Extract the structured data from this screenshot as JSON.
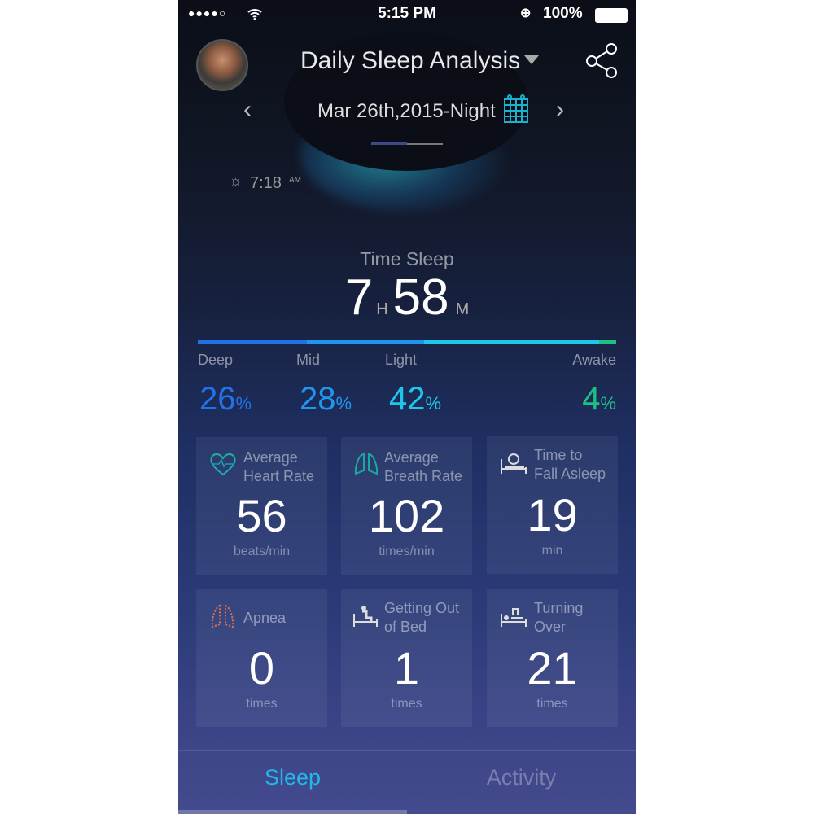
{
  "status_bar": {
    "signal_bars": 4,
    "signal_total": 5,
    "time": "5:15 PM",
    "battery": "100%"
  },
  "header": {
    "title": "Daily Sleep Analysis",
    "date": "Mar 26th,2015-Night",
    "wake_time": "7:18",
    "wake_ampm": "AM"
  },
  "summary": {
    "label": "Time Sleep",
    "hours": "7",
    "hours_unit": "H",
    "minutes": "58",
    "minutes_unit": "M"
  },
  "phases": [
    {
      "label": "Deep",
      "value": "26",
      "unit": "%",
      "percent": 26,
      "color": "#2272e6"
    },
    {
      "label": "Mid",
      "value": "28",
      "unit": "%",
      "percent": 28,
      "color": "#1e96ee"
    },
    {
      "label": "Light",
      "value": "42",
      "unit": "%",
      "percent": 42,
      "color": "#1fc6ea"
    },
    {
      "label": "Awake",
      "value": "4",
      "unit": "%",
      "percent": 4,
      "color": "#1fbf84"
    }
  ],
  "cards": [
    {
      "label1": "Average",
      "label2": "Heart Rate",
      "value": "56",
      "unit": "beats/min",
      "icon": "heart-icon"
    },
    {
      "label1": "Average",
      "label2": "Breath Rate",
      "value": "102",
      "unit": "times/min",
      "icon": "lungs-icon"
    },
    {
      "label1": "Time to",
      "label2": "Fall Asleep",
      "value": "19",
      "unit": "min",
      "icon": "bed-clock-icon"
    },
    {
      "label1": "Apnea",
      "label2": "",
      "value": "0",
      "unit": "times",
      "icon": "lungs-hatched-icon"
    },
    {
      "label1": "Getting Out",
      "label2": "of Bed",
      "value": "1",
      "unit": "times",
      "icon": "bed-sitting-icon"
    },
    {
      "label1": "Turning",
      "label2": "Over",
      "value": "21",
      "unit": "times",
      "icon": "bed-turning-icon"
    }
  ],
  "tabs": [
    {
      "label": "Sleep",
      "active": true
    },
    {
      "label": "Activity",
      "active": false
    }
  ],
  "colors": {
    "accent": "#22b8e8"
  }
}
